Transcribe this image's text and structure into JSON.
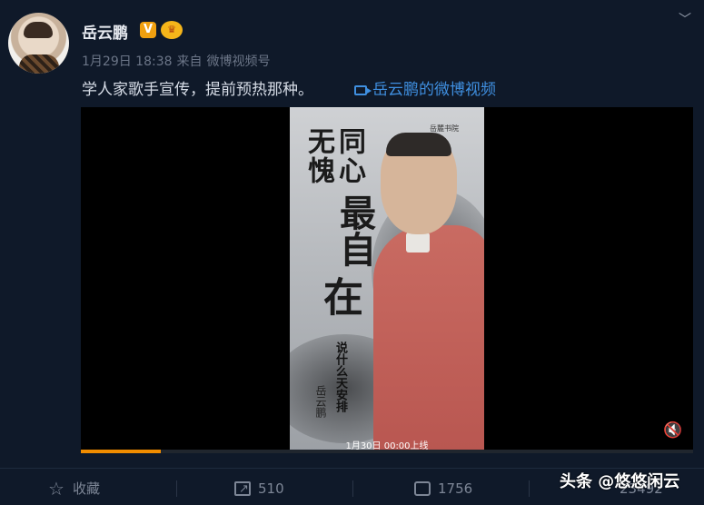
{
  "post": {
    "username": "岳云鹏",
    "badge_v": "V",
    "badge_crown": "♛",
    "date": "1月29日 18:38",
    "from_prefix": "来自",
    "source": "微博视频号",
    "text": "学人家歌手宣传，提前预热那种。",
    "video_link_label": "岳云鹏的微博视频"
  },
  "video": {
    "poster_title_line1": "同心",
    "poster_title_line2": "无愧",
    "poster_title_big1": "最自",
    "poster_title_big2": "在",
    "poster_subtitle": "说什么天安排",
    "poster_name": "岳云鹏",
    "poster_logo": "岳麓书院",
    "release_text": "1月30日 00:00上线",
    "progress": 0.13,
    "muted_icon": "mute-icon"
  },
  "actions": {
    "favorite_label": "收藏",
    "share_count": "510",
    "comment_count": "1756",
    "like_count": "23492"
  },
  "watermark": "头条 @悠悠闲云",
  "colors": {
    "background": "#0f1929",
    "link": "#3f8fe0",
    "progress": "#f08c00"
  }
}
